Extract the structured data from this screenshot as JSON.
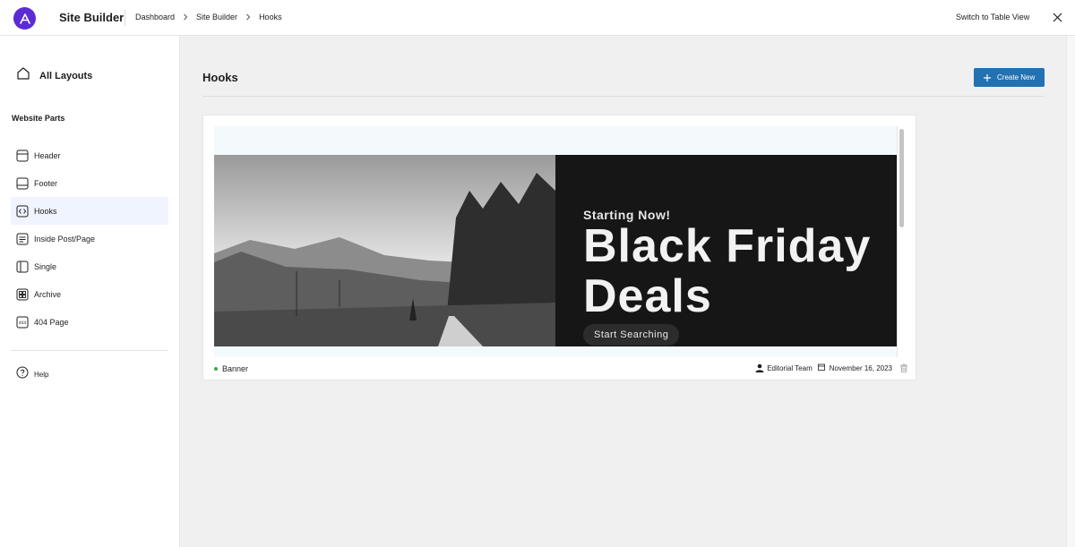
{
  "app": {
    "title": "Site Builder",
    "logo_icon": "astra-logo-icon",
    "brand_color": "#5b2bd6"
  },
  "breadcrumb": [
    "Dashboard",
    "Site Builder",
    "Hooks"
  ],
  "topbar": {
    "switch_view": "Switch to Table View",
    "close_icon": "close-icon"
  },
  "sidebar": {
    "all_layouts": "All Layouts",
    "section_title": "Website Parts",
    "items": [
      {
        "label": "Header",
        "icon": "header-layout-icon",
        "active": false
      },
      {
        "label": "Footer",
        "icon": "footer-layout-icon",
        "active": false
      },
      {
        "label": "Hooks",
        "icon": "code-icon",
        "active": true
      },
      {
        "label": "Inside Post/Page",
        "icon": "inside-post-icon",
        "active": false
      },
      {
        "label": "Single",
        "icon": "single-icon",
        "active": false
      },
      {
        "label": "Archive",
        "icon": "archive-icon",
        "active": false
      },
      {
        "label": "404 Page",
        "icon": "404-icon",
        "active": false
      }
    ],
    "help": "Help"
  },
  "main": {
    "title": "Hooks",
    "create_button": "Create New",
    "accent_color": "#2271b1"
  },
  "card": {
    "banner": {
      "kicker": "Starting Now!",
      "headline": "Black Friday Deals",
      "cta": "Start Searching"
    },
    "item_title": "Banner",
    "status_color": "#3fa34d",
    "author": "Editorial Team",
    "date": "November 16, 2023"
  }
}
